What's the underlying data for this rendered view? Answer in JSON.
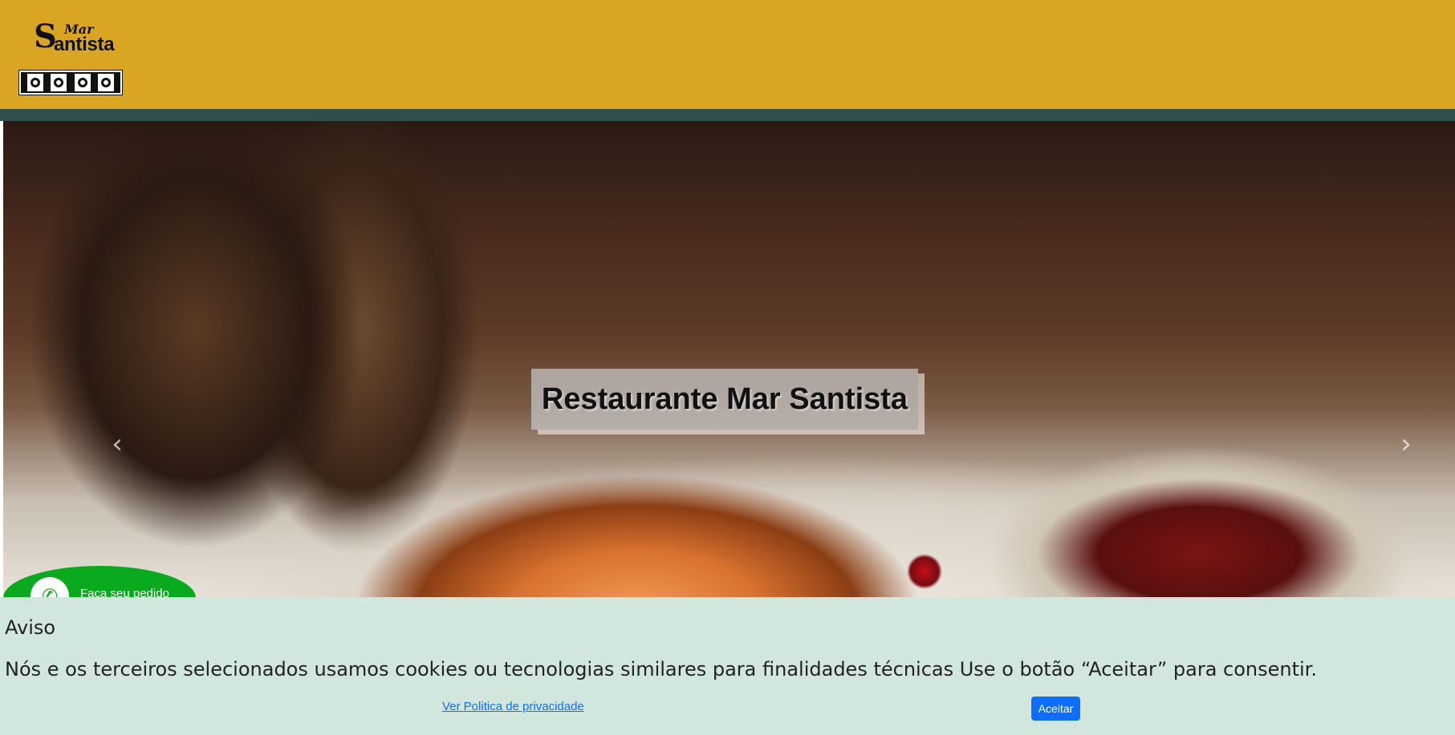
{
  "header": {
    "logo": {
      "s": "S",
      "mar": "Mar",
      "santista": "antista"
    },
    "background_color": "#DAA520",
    "band_color": "#2F4F4F"
  },
  "hero": {
    "title": "Restaurante Mar Santista",
    "prev_icon": "chevron-left-icon",
    "next_icon": "chevron-right-icon",
    "prev_glyph": "‹",
    "next_glyph": "›"
  },
  "whatsapp": {
    "icon": "whatsapp-phone-icon",
    "glyph": "✆",
    "label": "Faça seu pedido",
    "color": "#0AAA1E"
  },
  "cookie_notice": {
    "title": "Aviso",
    "message": "Nós e os terceiros selecionados usamos cookies ou tecnologias similares para finalidades técnicas Use o botão “Aceitar” para consentir.",
    "privacy_link": "Ver Politica de privacidade",
    "accept_label": "Aceitar",
    "background_color": "#D1E7DD",
    "accent_color": "#0D6EFD"
  }
}
